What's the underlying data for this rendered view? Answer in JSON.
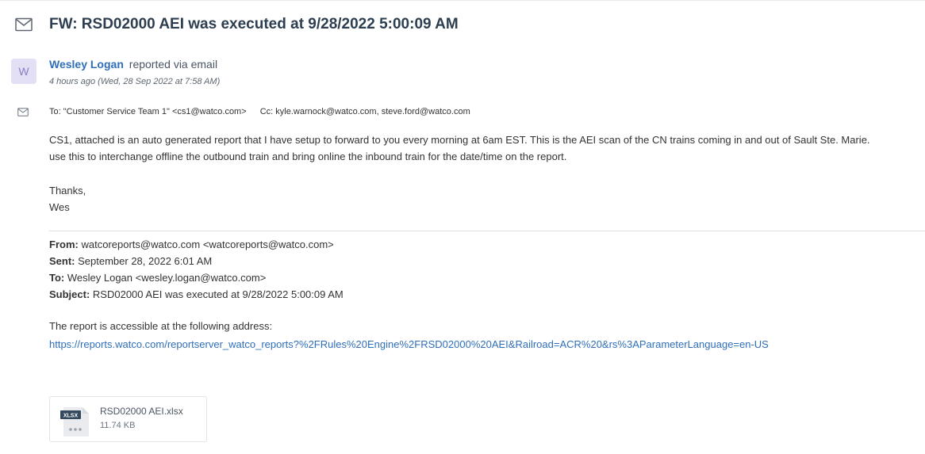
{
  "ticket": {
    "title": "FW: RSD02000 AEI was executed at 9/28/2022 5:00:09 AM",
    "icon": "envelope-icon"
  },
  "reporter": {
    "avatar_letter": "W",
    "name": "Wesley Logan",
    "via": "reported via email",
    "timestamp": "4 hours ago (Wed, 28 Sep 2022 at 7:58 AM)"
  },
  "recipients": {
    "to": "To: \"Customer Service Team 1\" <cs1@watco.com>",
    "cc": "Cc: kyle.warnock@watco.com, steve.ford@watco.com"
  },
  "body": {
    "line1": "CS1, attached is an auto generated report that I have setup to forward to you every morning at 6am EST. This is the AEI scan of the CN trains coming in and out of Sault Ste. Marie.",
    "line2": "use this to interchange offline the outbound train and bring online the inbound train for the date/time on the report.",
    "thanks": "Thanks,",
    "signature": "Wes"
  },
  "forwarded": {
    "from_label": "From:",
    "from_value": "watcoreports@watco.com <watcoreports@watco.com>",
    "sent_label": "Sent:",
    "sent_value": "September 28, 2022 6:01 AM",
    "to_label": "To:",
    "to_value": "Wesley Logan <wesley.logan@watco.com>",
    "subject_label": "Subject:",
    "subject_value": "RSD02000 AEI was executed at 9/28/2022 5:00:09 AM",
    "report_line": "The report is accessible at the following address:",
    "report_link": "https://reports.watco.com/reportserver_watco_reports?%2FRules%20Engine%2FRSD02000%20AEI&Railroad=ACR%20&rs%3AParameterLanguage=en-US"
  },
  "attachment": {
    "badge": "XLSX",
    "name": "RSD02000 AEI.xlsx",
    "size": "11.74 KB"
  },
  "colors": {
    "link": "#2f6fba",
    "title": "#2c3e50",
    "avatar_bg": "#e3dff4"
  }
}
